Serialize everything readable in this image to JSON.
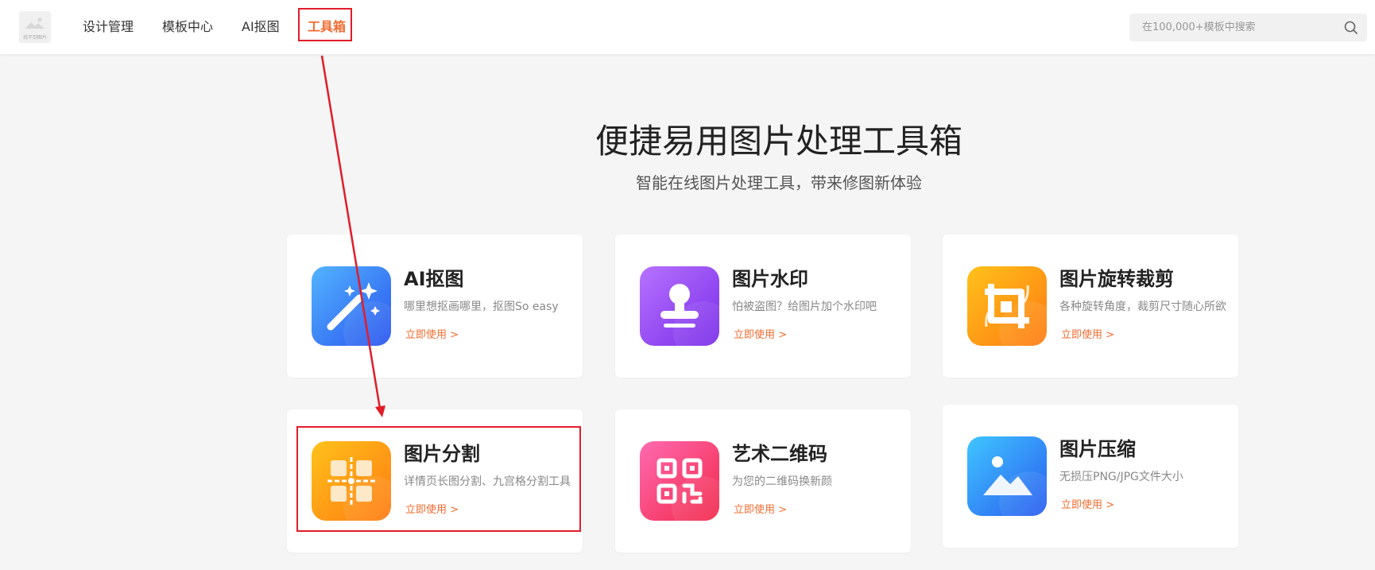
{
  "header": {
    "logo_text": "找不到图片",
    "nav": [
      {
        "label": "设计管理",
        "active": false
      },
      {
        "label": "模板中心",
        "active": false
      },
      {
        "label": "AI抠图",
        "active": false
      },
      {
        "label": "工具箱",
        "active": true
      }
    ],
    "search": {
      "placeholder": "在100,000+模板中搜索",
      "value": ""
    }
  },
  "hero": {
    "title": "便捷易用图片处理工具箱",
    "subtitle": "智能在线图片处理工具，带来修图新体验"
  },
  "tools": [
    {
      "title": "AI抠图",
      "desc": "哪里想抠画哪里，抠图So easy",
      "cta": "立即使用 >",
      "icon": "magic-wand-icon"
    },
    {
      "title": "图片水印",
      "desc": "怕被盗图？给图片加个水印吧",
      "cta": "立即使用 >",
      "icon": "stamp-icon"
    },
    {
      "title": "图片旋转裁剪",
      "desc": "各种旋转角度，裁剪尺寸随心所欲",
      "cta": "立即使用 >",
      "icon": "crop-rotate-icon"
    },
    {
      "title": "图片分割",
      "desc": "详情页长图分割、九宫格分割工具",
      "cta": "立即使用 >",
      "icon": "grid-split-icon"
    },
    {
      "title": "艺术二维码",
      "desc": "为您的二维码换新颜",
      "cta": "立即使用 >",
      "icon": "qr-code-icon"
    },
    {
      "title": "图片压缩",
      "desc": "无损压PNG/JPG文件大小",
      "cta": "立即使用 >",
      "icon": "image-compress-icon"
    }
  ],
  "colors": {
    "accent": "#f26b2f",
    "annotation_red": "#e11d2a",
    "blue": "#2f6cf0",
    "purple": "#8a3ff0",
    "orange": "#ff8a10",
    "pink": "#f4306f"
  }
}
